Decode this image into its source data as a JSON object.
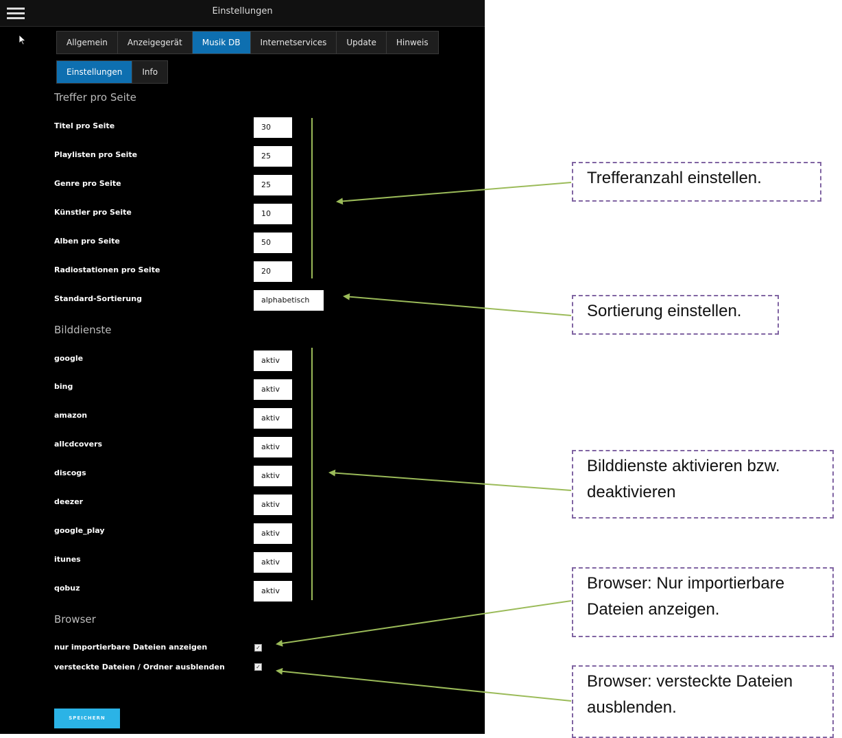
{
  "window": {
    "title": "Einstellungen"
  },
  "tabs": [
    "Allgemein",
    "Anzeigegerät",
    "Musik DB",
    "Internetservices",
    "Update",
    "Hinweis"
  ],
  "subtabs": [
    "Einstellungen",
    "Info"
  ],
  "sections": {
    "treffer": "Treffer pro Seite",
    "bilddienste": "Bilddienste",
    "browser": "Browser"
  },
  "treffer_rows": [
    {
      "label": "Titel pro Seite",
      "value": "30"
    },
    {
      "label": "Playlisten pro Seite",
      "value": "25"
    },
    {
      "label": "Genre pro Seite",
      "value": "25"
    },
    {
      "label": "Künstler pro Seite",
      "value": "10"
    },
    {
      "label": "Alben pro Seite",
      "value": "50"
    },
    {
      "label": "Radiostationen pro Seite",
      "value": "20"
    },
    {
      "label": "Standard-Sortierung",
      "value": "alphabetisch"
    }
  ],
  "bild_rows": [
    {
      "label": "google",
      "value": "aktiv"
    },
    {
      "label": "bing",
      "value": "aktiv"
    },
    {
      "label": "amazon",
      "value": "aktiv"
    },
    {
      "label": "allcdcovers",
      "value": "aktiv"
    },
    {
      "label": "discogs",
      "value": "aktiv"
    },
    {
      "label": "deezer",
      "value": "aktiv"
    },
    {
      "label": "google_play",
      "value": "aktiv"
    },
    {
      "label": "itunes",
      "value": "aktiv"
    },
    {
      "label": "qobuz",
      "value": "aktiv"
    }
  ],
  "browser_rows": [
    {
      "label": "nur importierbare Dateien anzeigen",
      "checked": true
    },
    {
      "label": "versteckte Dateien / Ordner ausblenden",
      "checked": true
    }
  ],
  "checkbox_mark": "✓",
  "save_label": "SPEICHERN",
  "callouts": {
    "treffer": "Trefferanzahl einstellen.",
    "sortierung": "Sortierung einstellen.",
    "bild_1": "Bilddienste aktivieren bzw.",
    "bild_2": "deaktivieren",
    "browser1_1": "Browser: Nur importierbare",
    "browser1_2": "Dateien anzeigen.",
    "browser2_1": "Browser: versteckte Dateien",
    "browser2_2": "ausblenden."
  },
  "colors": {
    "active_tab": "#0e6fb0",
    "save_button": "#2bb3e6",
    "arrow_green": "#9bbb59",
    "callout_border": "#8064a2"
  },
  "icons": {
    "menu": "hamburger-menu-icon",
    "pointer": "mouse-pointer-icon"
  }
}
